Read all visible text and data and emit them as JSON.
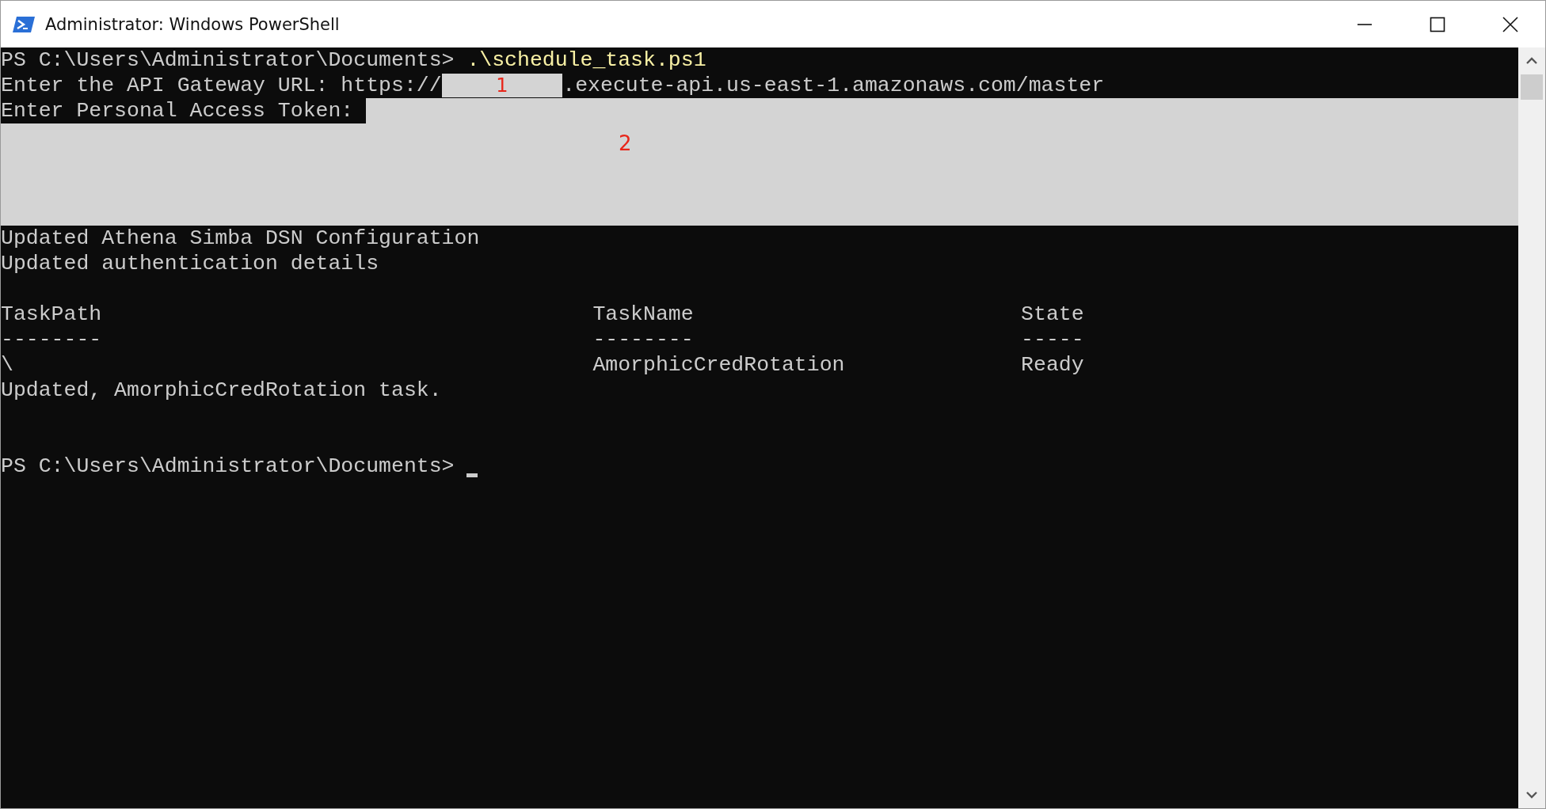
{
  "window": {
    "title": "Administrator: Windows PowerShell"
  },
  "console": {
    "command_line": {
      "prompt": "PS C:\\Users\\Administrator\\Documents>",
      "command": ".\\schedule_task.ps1"
    },
    "url_line": {
      "label": "Enter the API Gateway URL: https://",
      "redaction_label": "1",
      "rest": ".execute-api.us-east-1.amazonaws.com/master"
    },
    "token_line": {
      "label": "Enter Personal Access Token:",
      "redaction_label": "2"
    },
    "messages": [
      "Updated Athena Simba DSN Configuration",
      "Updated authentication details"
    ],
    "table": {
      "columns": [
        "TaskPath",
        "TaskName",
        "State"
      ],
      "separators": [
        "--------",
        "--------",
        "-----"
      ],
      "rows": [
        [
          "\\",
          "AmorphicCredRotation",
          "Ready"
        ]
      ]
    },
    "result": "Updated, AmorphicCredRotation task.",
    "prompt": "PS C:\\Users\\Administrator\\Documents>"
  }
}
